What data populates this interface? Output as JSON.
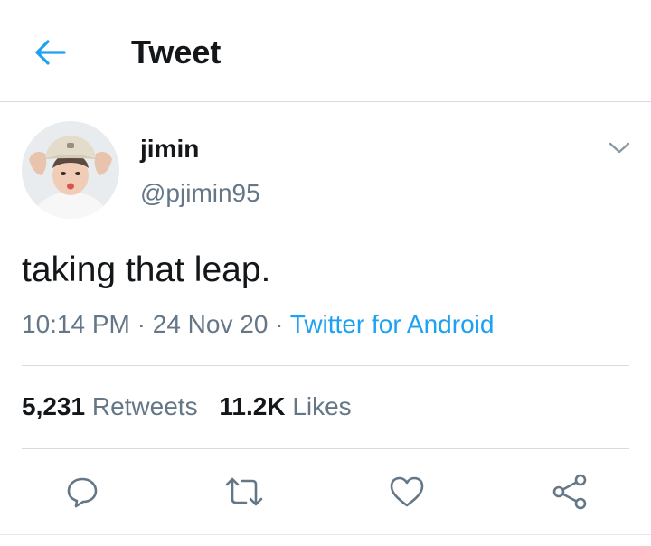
{
  "header": {
    "title": "Tweet",
    "back_icon": "arrow-left-icon",
    "accent_color": "#1da1f2"
  },
  "tweet": {
    "author": {
      "display_name": "jimin",
      "handle": "@pjimin95",
      "avatar_icon": "avatar-photo"
    },
    "text": "taking that leap.",
    "time": "10:14 PM",
    "separator": " · ",
    "date": "24 Nov 20",
    "source": "Twitter for Android",
    "menu_icon": "chevron-down-icon"
  },
  "stats": {
    "retweets_count": "5,231",
    "retweets_label": "Retweets",
    "likes_count": "11.2K",
    "likes_label": "Likes"
  },
  "actions": {
    "reply_icon": "reply-icon",
    "retweet_icon": "retweet-icon",
    "like_icon": "heart-icon",
    "share_icon": "share-icon"
  }
}
